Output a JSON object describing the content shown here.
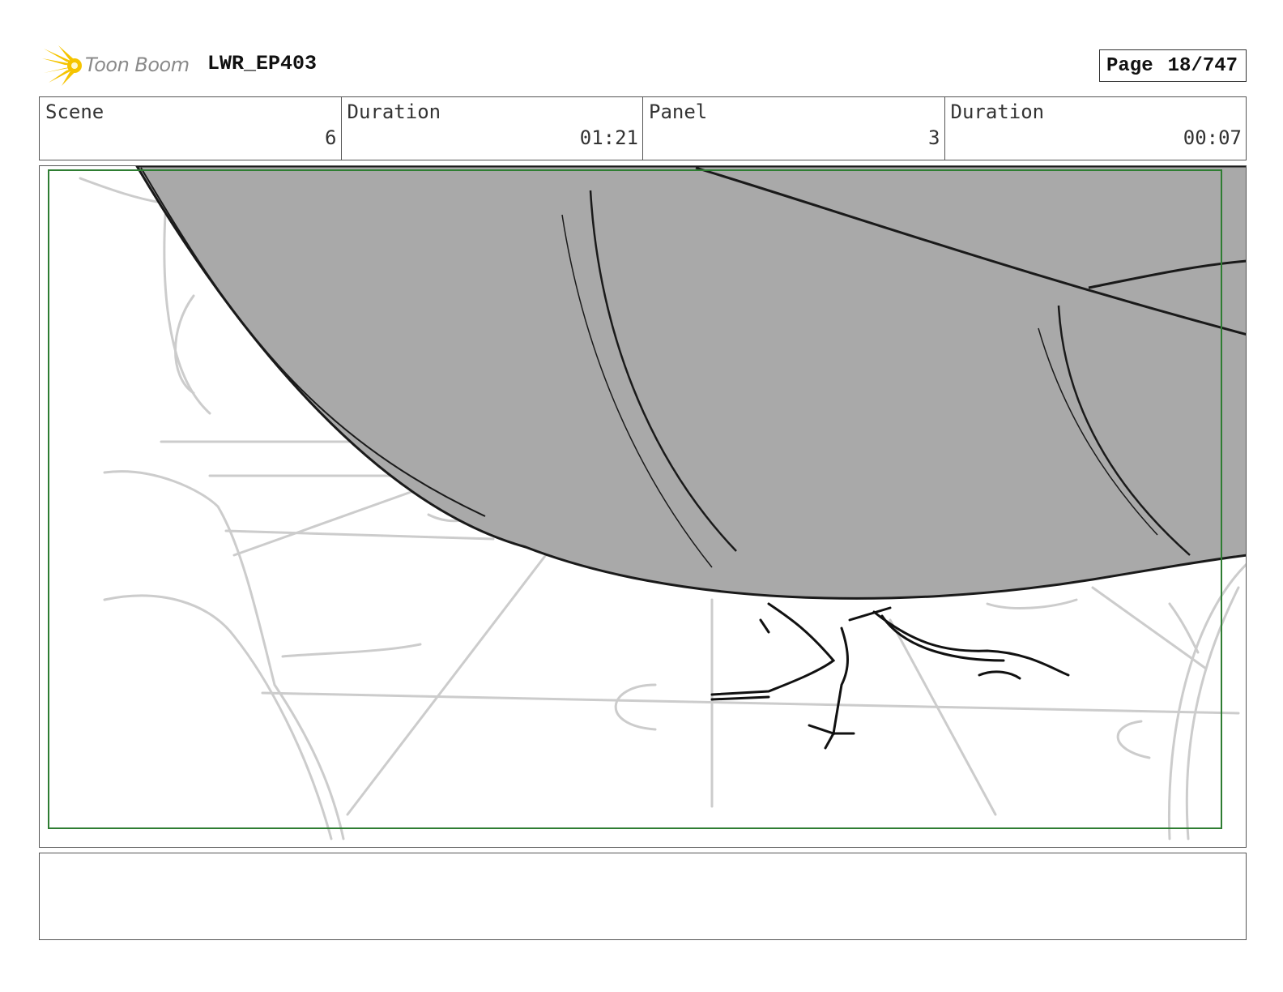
{
  "header": {
    "logo_text": "Toon Boom",
    "project": "LWR_EP403",
    "page_label": "Page",
    "page_number": "18/747"
  },
  "info": [
    {
      "label": "Scene",
      "value": "6"
    },
    {
      "label": "Duration",
      "value": "01:21"
    },
    {
      "label": "Panel",
      "value": "3"
    },
    {
      "label": "Duration",
      "value": "00:07"
    }
  ],
  "notes": {
    "text": ""
  },
  "colors": {
    "safe_frame": "#2e7d32",
    "sketch_fill": "#a9a9a9",
    "background_lines": "#cccccc",
    "logo_accent": "#f5c400"
  },
  "icons": {
    "logo": "toon-boom-starburst-icon"
  }
}
